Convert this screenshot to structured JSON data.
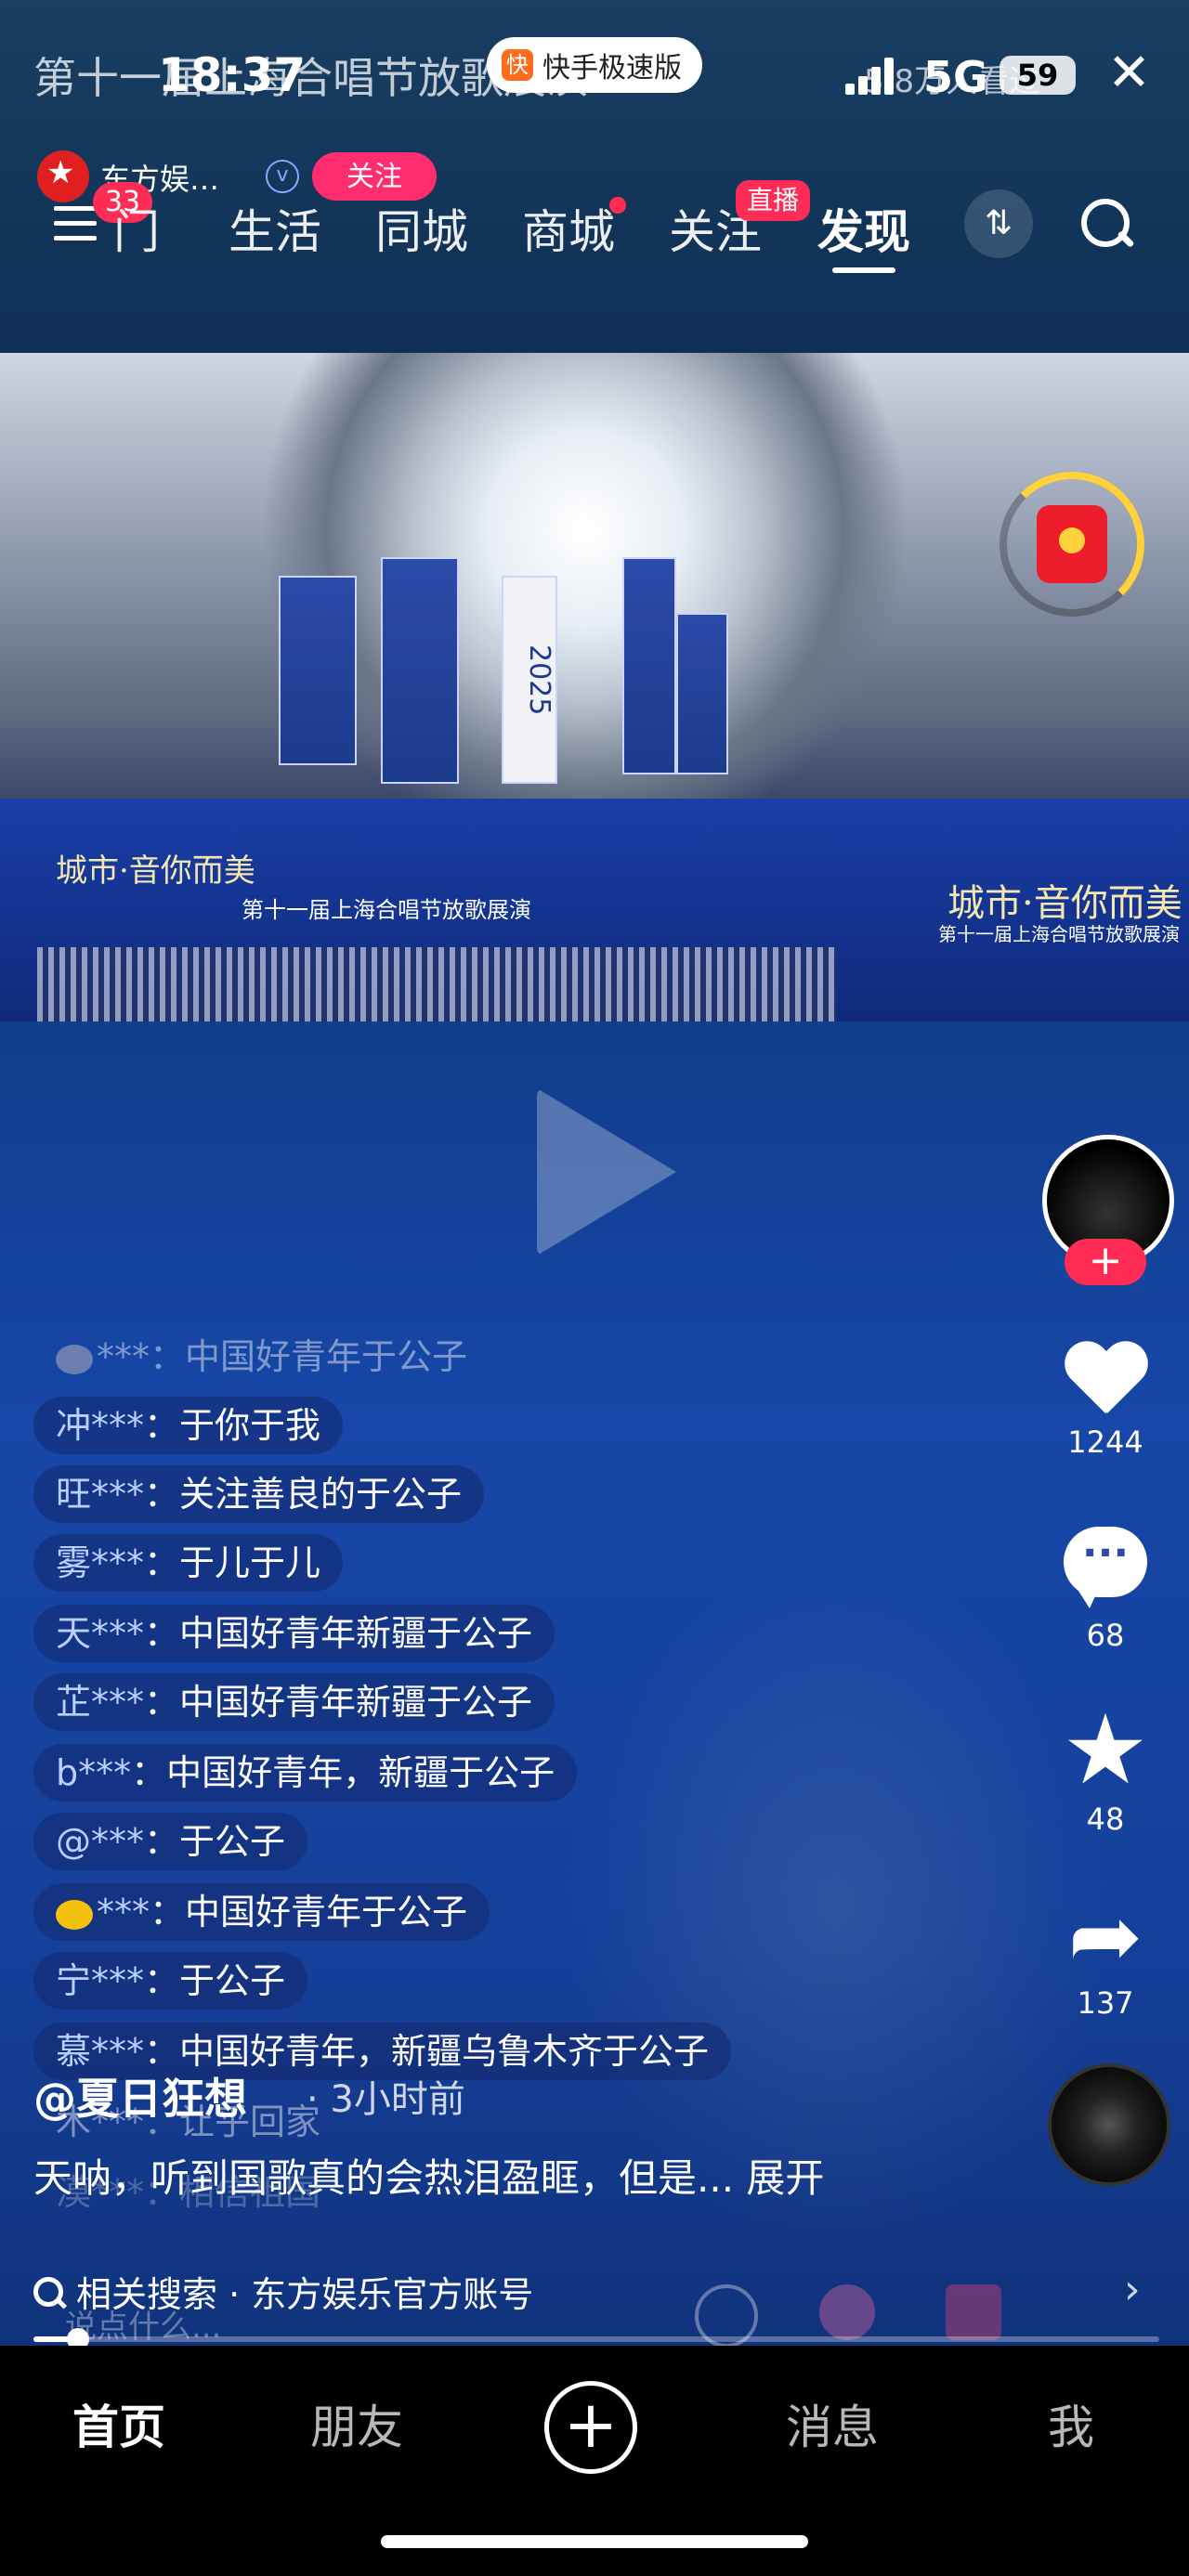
{
  "status_bar": {
    "time": "18:37",
    "network": "5G",
    "battery": "59",
    "viewers": "5.8万人看过"
  },
  "live_title": "第十一届上海合唱节放歌展演",
  "app_pill": {
    "logo": "快",
    "label": "快手极速版"
  },
  "host": {
    "name": "东方娱…",
    "follow_label": "关注",
    "notif_count": "33"
  },
  "nav": {
    "tabs": [
      {
        "label": "门"
      },
      {
        "label": "生活"
      },
      {
        "label": "同城"
      },
      {
        "label": "商城"
      },
      {
        "label": "关注"
      },
      {
        "label": "发现"
      }
    ],
    "live_badge": "直播",
    "switch_icon": "⇅"
  },
  "video": {
    "stage_text_left": "城市·音你而美",
    "stage_text_mid": "第十一届上海合唱节放歌展演",
    "stage_text_right": "城市·音你而美",
    "stage_sub_right": "第十一届上海合唱节放歌展演",
    "banner_year": "2025"
  },
  "side": {
    "follow_plus": "+",
    "likes": "1244",
    "comments": "68",
    "favorites": "48",
    "shares": "137",
    "comment_glyph": "···"
  },
  "comments": [
    {
      "user": "***",
      "sep": "：",
      "text": "中国好青年于公子",
      "emoji": "gray"
    },
    {
      "user": "冲***",
      "sep": "：",
      "text": "于你于我"
    },
    {
      "user": "旺***",
      "sep": "：",
      "text": "关注善良的于公子"
    },
    {
      "user": "雾***",
      "sep": "：",
      "text": "于儿于儿"
    },
    {
      "user": "天***",
      "sep": "：",
      "text": "中国好青年新疆于公子"
    },
    {
      "user": "芷***",
      "sep": "：",
      "text": "中国好青年新疆于公子"
    },
    {
      "user": "b***",
      "sep": "：",
      "text": "中国好青年，新疆于公子"
    },
    {
      "user": "@***",
      "sep": "：",
      "text": "于公子"
    },
    {
      "user": "***",
      "sep": "：",
      "text": "中国好青年于公子",
      "emoji": "lemon"
    },
    {
      "user": "宁***",
      "sep": "：",
      "text": "于公子"
    },
    {
      "user": "慕***",
      "sep": "：",
      "text": "中国好青年，新疆乌鲁木齐于公子"
    },
    {
      "user": "木***",
      "sep": "：",
      "text": "让乎回家"
    },
    {
      "user": "漠***",
      "sep": "：",
      "text": "相信祖国"
    }
  ],
  "post": {
    "author": "@夏日狂想",
    "time": "· 3小时前",
    "caption": "天呐，听到国歌真的会热泪盈眶，但是... 展开"
  },
  "related_search": "相关搜索 · 东方娱乐官方账号",
  "input_placeholder": "说点什么...",
  "progress": {
    "fraction": 0.04
  },
  "bottom_nav": {
    "home": "首页",
    "friends": "朋友",
    "plus": "+",
    "messages": "消息",
    "me": "我"
  }
}
